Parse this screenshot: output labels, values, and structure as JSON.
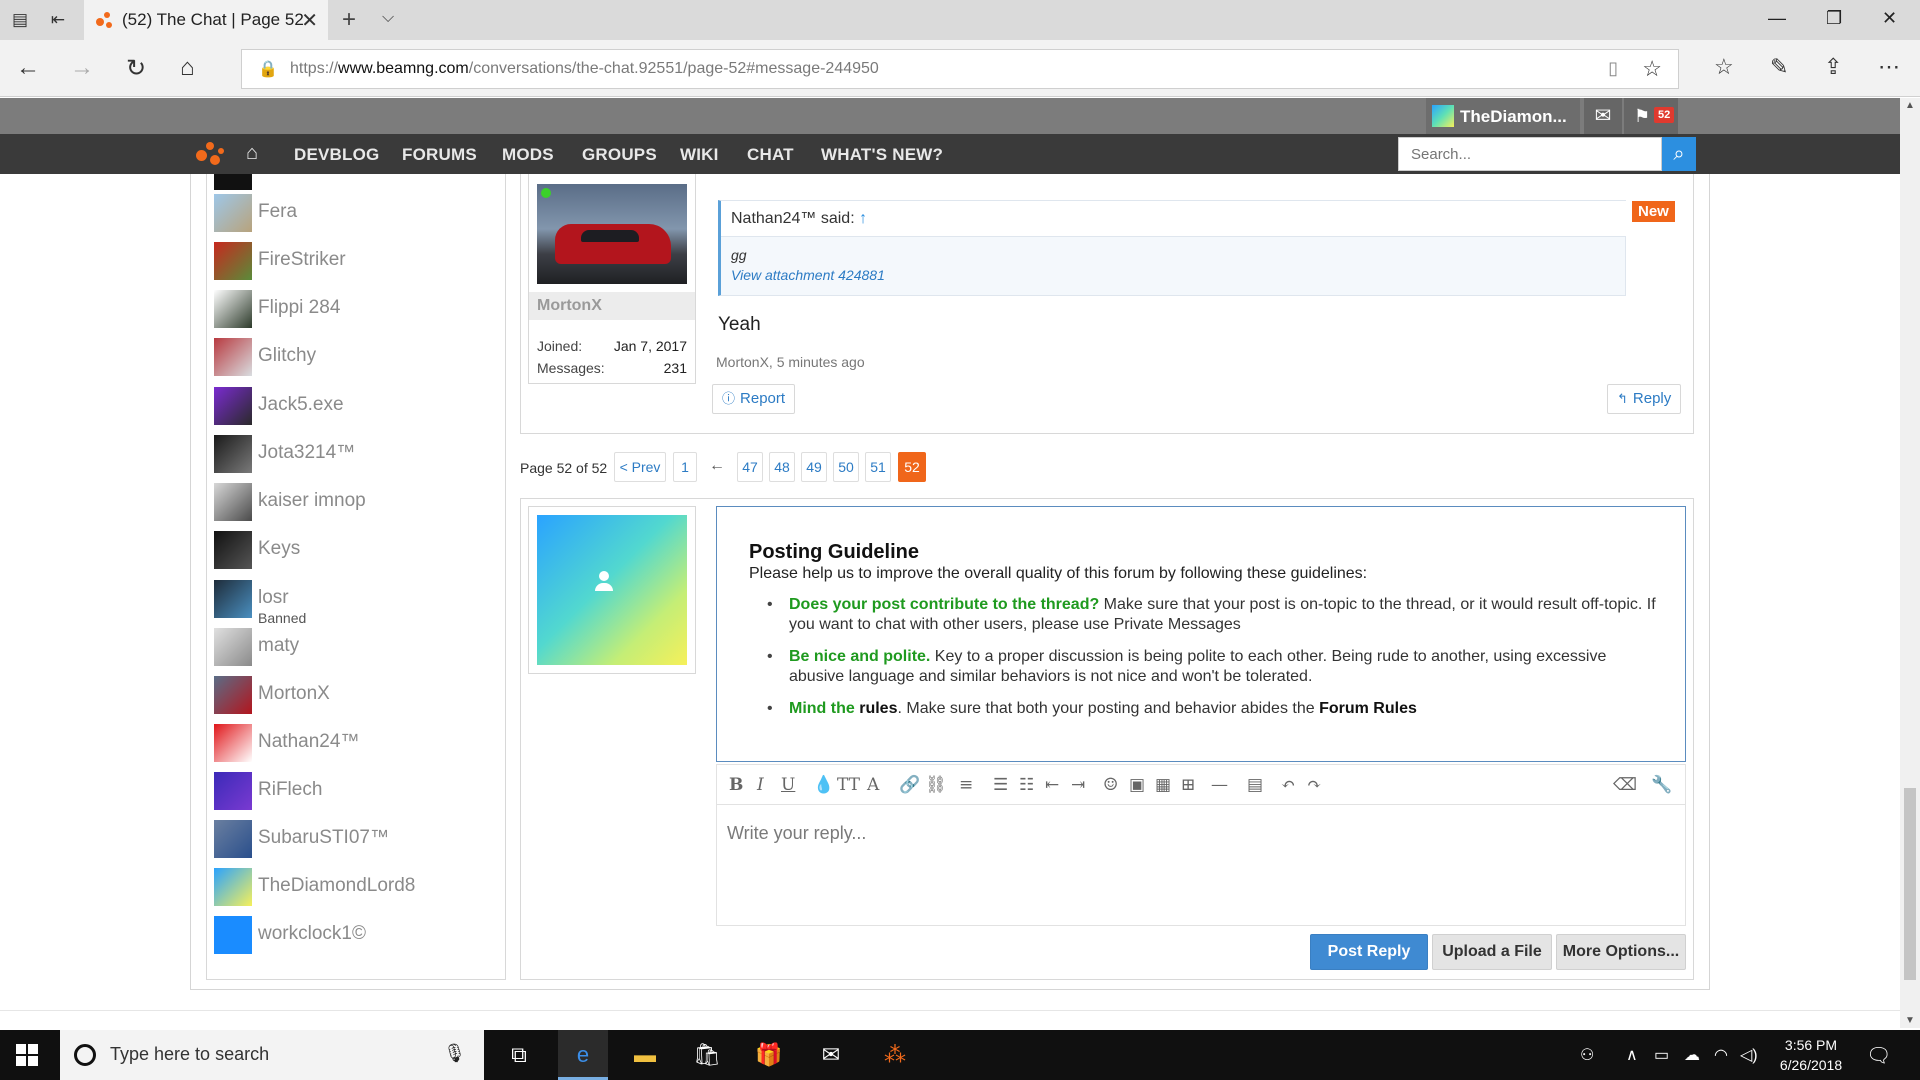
{
  "browser": {
    "tab_title": "(52) The Chat | Page 52",
    "url_prefix": "https://",
    "url_host": "www.beamng.com",
    "url_path": "/conversations/the-chat.92551/page-52#message-244950"
  },
  "site": {
    "user_name": "TheDiamon...",
    "alerts_count": "52",
    "nav": [
      "DEVBLOG",
      "FORUMS",
      "MODS",
      "GROUPS",
      "WIKI",
      "CHAT",
      "WHAT'S NEW?"
    ],
    "search_placeholder": "Search..."
  },
  "members": [
    {
      "name": "Fera",
      "colors": [
        "#9ec7e8",
        "#b8a37c"
      ]
    },
    {
      "name": "FireStriker",
      "colors": [
        "#c7281e",
        "#5a8c3a"
      ]
    },
    {
      "name": "Flippi 284",
      "colors": [
        "#ffffff",
        "#2c3a2a"
      ]
    },
    {
      "name": "Glitchy",
      "colors": [
        "#b83a40",
        "#d9dde0"
      ]
    },
    {
      "name": "Jack5.exe",
      "colors": [
        "#7a2bd1",
        "#2a2a2a"
      ]
    },
    {
      "name": "Jota3214™",
      "colors": [
        "#1a1a1a",
        "#7a7a7a"
      ]
    },
    {
      "name": "kaiser imnop",
      "colors": [
        "#d8d8d8",
        "#4a4a4a"
      ]
    },
    {
      "name": "Keys",
      "colors": [
        "#111111",
        "#555555"
      ]
    },
    {
      "name": "losr",
      "sub": "Banned",
      "colors": [
        "#1e2c3a",
        "#4a8fc0"
      ]
    },
    {
      "name": "maty",
      "colors": [
        "#e0e0e0",
        "#8a8a8a"
      ]
    },
    {
      "name": "MortonX",
      "colors": [
        "#5a6d87",
        "#b3151d"
      ]
    },
    {
      "name": "Nathan24™",
      "colors": [
        "#e0161a",
        "#ffffff"
      ]
    },
    {
      "name": "RiFlech",
      "colors": [
        "#3b2ab8",
        "#7a3ad1"
      ]
    },
    {
      "name": "SubaruSTI07™",
      "colors": [
        "#6a7fa0",
        "#2a4f8c"
      ]
    },
    {
      "name": "TheDiamondLord8",
      "colors": [
        "#2aa3ff",
        "#f6f05a"
      ]
    },
    {
      "name": "workclock1©",
      "colors": [
        "#1a8cff",
        "#1a8cff"
      ]
    }
  ],
  "post": {
    "author": "MortonX",
    "joined_label": "Joined:",
    "joined": "Jan 7, 2017",
    "messages_label": "Messages:",
    "messages": "231",
    "quote_author": "Nathan24™ said:",
    "quote_arrow": "↑",
    "quote_text": "gg",
    "quote_attachment": "View attachment 424881",
    "new_badge": "New",
    "text": "Yeah",
    "meta": "MortonX, 5 minutes ago",
    "report": "Report",
    "reply": "Reply"
  },
  "pagination": {
    "label": "Page 52 of 52",
    "prev": "< Prev",
    "first": "1",
    "ellipsis_arrow": "←",
    "pages": [
      "47",
      "48",
      "49",
      "50",
      "51"
    ],
    "current": "52"
  },
  "guideline": {
    "title": "Posting Guideline",
    "intro": "Please help us to improve the overall quality of this forum by following these guidelines:",
    "items": [
      {
        "bold": "Does your post contribute to the thread?",
        "text": " Make sure that your post is on-topic to the thread, or it would result off-topic. If you want to chat with other users, please use Private Messages"
      },
      {
        "bold": "Be nice and polite.",
        "text": " Key to a proper discussion is being polite to each other. Being rude to another, using excessive abusive language and similar behaviors is not nice and won't be tolerated."
      },
      {
        "bold": "Mind the",
        "bold_dark": "rules",
        "text": ". Make sure that both your posting and behavior abides the ",
        "link": "Forum Rules"
      }
    ]
  },
  "editor": {
    "placeholder": "Write your reply...",
    "post_reply": "Post Reply",
    "upload": "Upload a File",
    "more": "More Options..."
  },
  "taskbar": {
    "search_placeholder": "Type here to search",
    "time": "3:56 PM",
    "date": "6/26/2018"
  }
}
